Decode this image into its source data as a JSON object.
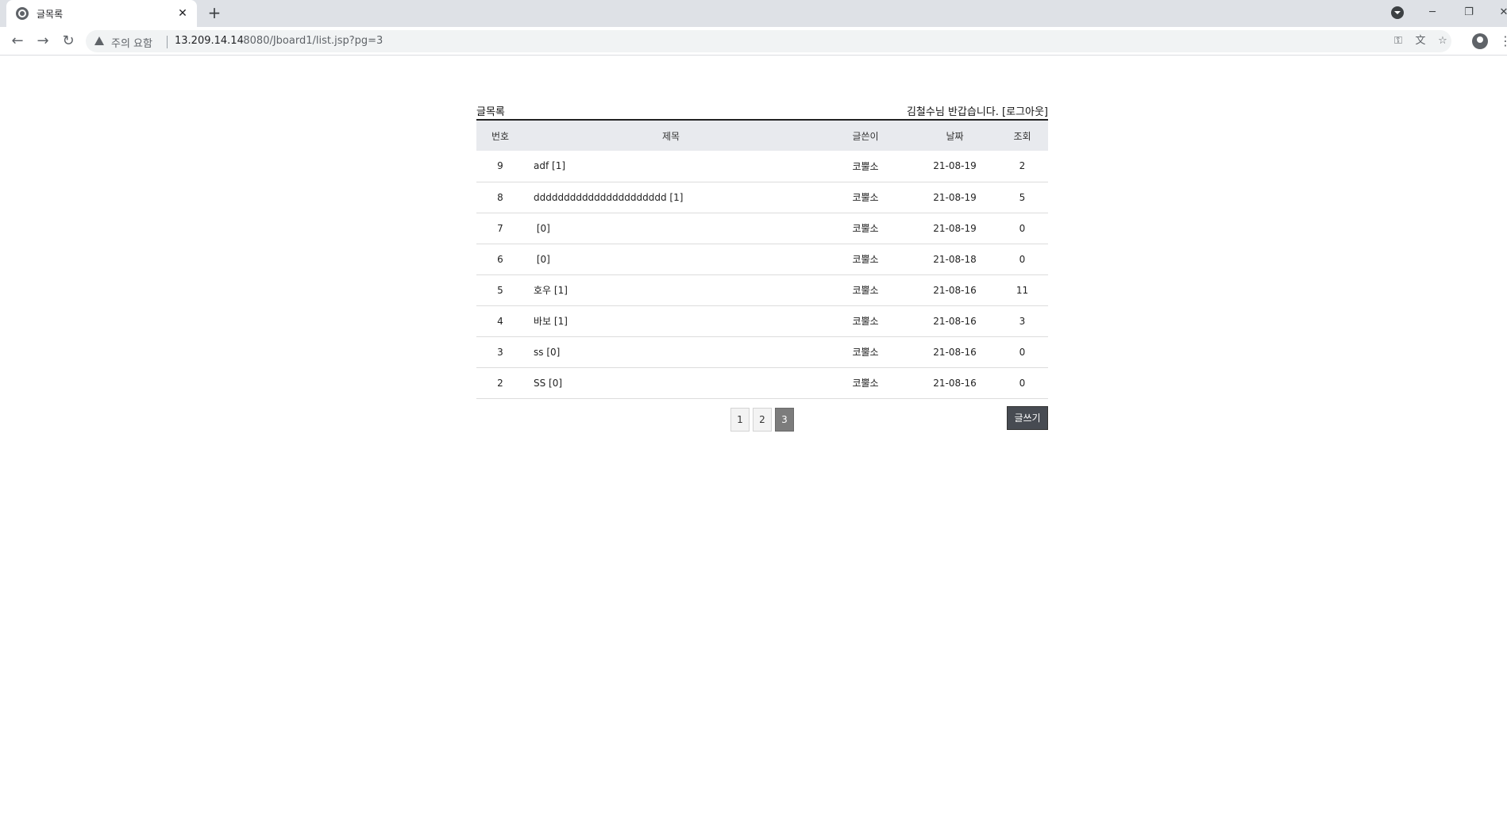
{
  "browser": {
    "tab_title": "글목록",
    "tab_close": "✕",
    "new_tab": "+",
    "window_controls": {
      "minimize": "─",
      "restore": "❐",
      "close": "✕"
    },
    "nav": {
      "back": "←",
      "forward": "→",
      "reload": "↻"
    },
    "security_label": "주의 요함",
    "url_host": "13.209.14.14",
    "url_path": ":8080/Jboard1/list.jsp?pg=3",
    "icons": [
      "key-icon",
      "translate-icon",
      "star-icon",
      "profile-icon",
      "menu-icon"
    ]
  },
  "board": {
    "title": "글목록",
    "greeting": "김철수님 반갑습니다. ",
    "logout": "[로그아웃]",
    "columns": [
      "번호",
      "제목",
      "글쓴이",
      "날짜",
      "조회"
    ],
    "rows": [
      {
        "no": "9",
        "subject": "adf [1]",
        "writer": "코뿔소",
        "date": "21-08-19",
        "hit": "2"
      },
      {
        "no": "8",
        "subject": "dddddddddddddddddddddd [1]",
        "writer": "코뿔소",
        "date": "21-08-19",
        "hit": "5"
      },
      {
        "no": "7",
        "subject": " [0]",
        "writer": "코뿔소",
        "date": "21-08-19",
        "hit": "0"
      },
      {
        "no": "6",
        "subject": " [0]",
        "writer": "코뿔소",
        "date": "21-08-18",
        "hit": "0"
      },
      {
        "no": "5",
        "subject": "호우 [1]",
        "writer": "코뿔소",
        "date": "21-08-16",
        "hit": "11"
      },
      {
        "no": "4",
        "subject": "바보 [1]",
        "writer": "코뿔소",
        "date": "21-08-16",
        "hit": "3"
      },
      {
        "no": "3",
        "subject": "ss [0]",
        "writer": "코뿔소",
        "date": "21-08-16",
        "hit": "0"
      },
      {
        "no": "2",
        "subject": "SS [0]",
        "writer": "코뿔소",
        "date": "21-08-16",
        "hit": "0"
      }
    ],
    "pages": [
      "1",
      "2",
      "3"
    ],
    "current_page": "3",
    "write_button": "글쓰기"
  }
}
